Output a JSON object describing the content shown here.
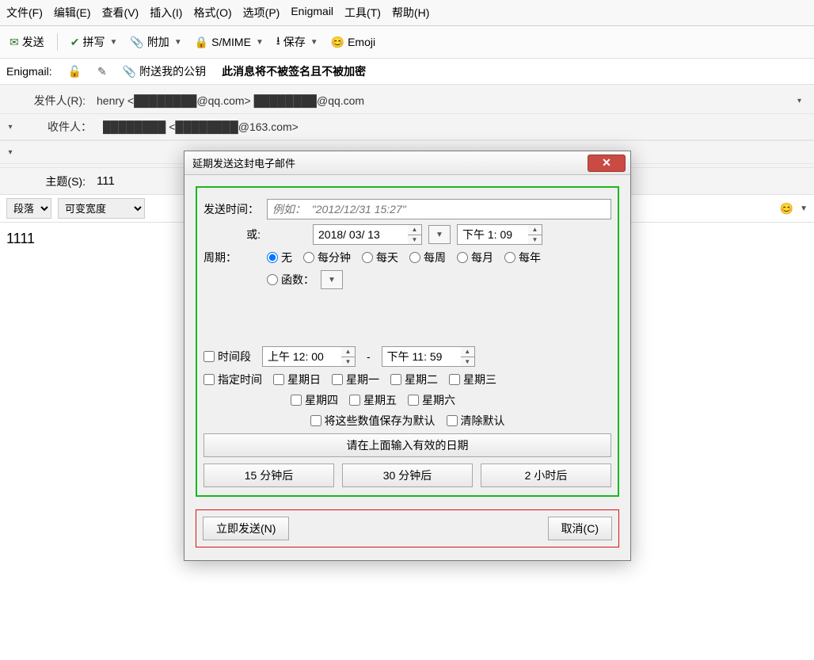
{
  "menubar": {
    "file": "文件(F)",
    "edit": "编辑(E)",
    "view": "查看(V)",
    "insert": "插入(I)",
    "format": "格式(O)",
    "options": "选项(P)",
    "enigmail": "Enigmail",
    "tools": "工具(T)",
    "help": "帮助(H)"
  },
  "toolbar": {
    "send": "发送",
    "spell": "拼写",
    "attach": "附加",
    "smime": "S/MIME",
    "save": "保存",
    "emoji": "Emoji"
  },
  "enigmail_row": {
    "label": "Enigmail:",
    "attach_key": "附送我的公钥",
    "status": "此消息将不被签名且不被加密"
  },
  "headers": {
    "from_label": "发件人(R):",
    "from_value": "henry <████████@qq.com>  ████████@qq.com",
    "to_label": "收件人：",
    "to_value": "████████ <████████@163.com>",
    "subject_label": "主题(S):",
    "subject_value": "111"
  },
  "format_bar": {
    "paragraph": "段落",
    "variable_width": "可变宽度"
  },
  "body_text": "1111",
  "dialog": {
    "title": "延期发送这封电子邮件",
    "send_time_label": "发送时间：",
    "send_time_placeholder": "例如：  \"2012/12/31 15:27\"",
    "or_label": "或:",
    "date_value": "2018/ 03/ 13",
    "time_value": "下午 1: 09",
    "period_label": "周期：",
    "radios": {
      "none": "无",
      "per_minute": "每分钟",
      "per_day": "每天",
      "per_week": "每周",
      "per_month": "每月",
      "per_year": "每年",
      "function": "函数："
    },
    "timerange_label": "时间段",
    "range_from": "上午 12: 00",
    "range_sep": "-",
    "range_to": "下午 11: 59",
    "restrict_label": "指定时间",
    "days": {
      "sun": "星期日",
      "mon": "星期一",
      "tue": "星期二",
      "wed": "星期三",
      "thu": "星期四",
      "fri": "星期五",
      "sat": "星期六"
    },
    "save_defaults": "将这些数值保存为默认",
    "clear_defaults": "清除默认",
    "enter_valid_date": "请在上面输入有效的日期",
    "btn_15m": "15 分钟后",
    "btn_30m": "30 分钟后",
    "btn_2h": "2 小时后",
    "send_now": "立即发送(N)",
    "cancel": "取消(C)"
  }
}
